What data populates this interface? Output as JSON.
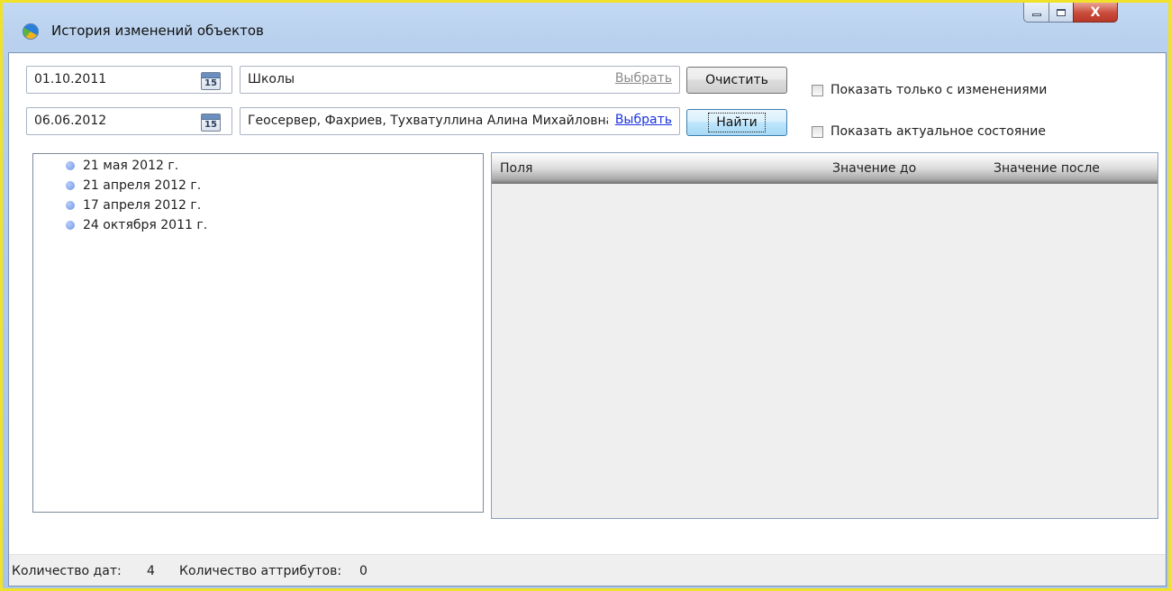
{
  "window": {
    "title": "История изменений объектов",
    "controls": {
      "close_label": "X"
    }
  },
  "filters": {
    "date_from": "01.10.2011",
    "date_to": "06.06.2012",
    "calendar_day": "15",
    "layer_value": "Школы",
    "users_value": "Геосервер, Фахриев, Тухватуллина Алина Михайловна",
    "pick_label": "Выбрать",
    "clear_button": "Очистить",
    "find_button": "Найти",
    "only_changes_label": "Показать только с изменениями",
    "actual_state_label": "Показать актуальное состояние",
    "only_changes_checked": false,
    "actual_state_checked": false
  },
  "dates": [
    "21 мая 2012 г.",
    "21 апреля 2012 г.",
    "17 апреля 2012 г.",
    "24 октября 2011 г."
  ],
  "grid": {
    "columns": [
      "Поля",
      "Значение до",
      "Значение после"
    ],
    "rows": []
  },
  "status": {
    "dates_label": "Количество дат:",
    "dates_count": "4",
    "attrs_label": "Количество аттрибутов:",
    "attrs_count": "0"
  },
  "colors": {
    "window_border": "#f0e22a",
    "link_active": "#1c33e0",
    "link_disabled": "#8a8a8a",
    "date_bullet": "#7196e8"
  }
}
